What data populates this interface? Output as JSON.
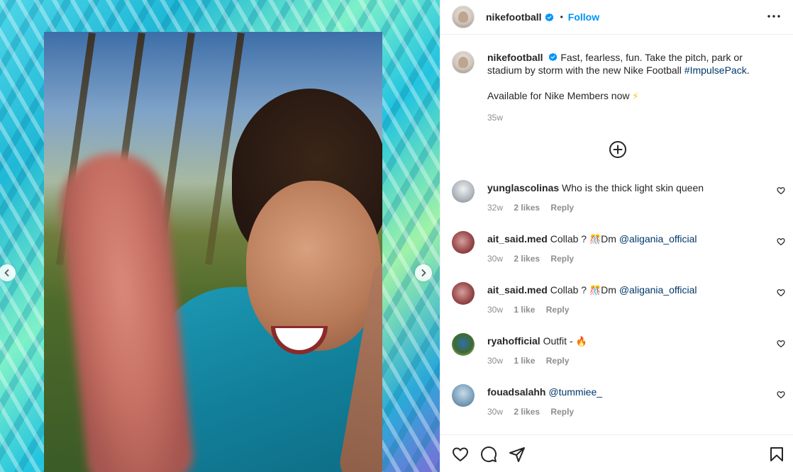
{
  "post": {
    "username": "nikefootball",
    "follow_label": "Follow",
    "separator": "•"
  },
  "caption": {
    "username": "nikefootball",
    "text": "Fast, fearless, fun. Take the pitch, park or stadium by storm with the new Nike Football ",
    "hashtag": "#ImpulsePack",
    "text_end": ".",
    "line2": "Available for Nike Members now",
    "line2_emoji": "⚡",
    "time": "35w"
  },
  "comments": [
    {
      "user": "yunglascolinas",
      "text": "Who is the thick light skin queen",
      "mention": "",
      "emoji": "",
      "time": "32w",
      "likes": "2 likes",
      "reply": "Reply"
    },
    {
      "user": "ait_said.med",
      "text": "Collab ? ",
      "emoji": "🎊",
      "text2": "Dm ",
      "mention": "@aliganiа_official",
      "time": "30w",
      "likes": "2 likes",
      "reply": "Reply"
    },
    {
      "user": "ait_said.med",
      "text": "Collab ? ",
      "emoji": "🎊",
      "text2": "Dm ",
      "mention": "@aliganiа_official",
      "time": "30w",
      "likes": "1 like",
      "reply": "Reply"
    },
    {
      "user": "ryahofficial",
      "text": "Outfit - ",
      "emoji": "🔥",
      "text2": "",
      "mention": "",
      "time": "30w",
      "likes": "1 like",
      "reply": "Reply"
    },
    {
      "user": "fouadsalahh",
      "text": "",
      "emoji": "",
      "text2": "",
      "mention": "@tummiee_",
      "time": "30w",
      "likes": "2 likes",
      "reply": "Reply"
    }
  ],
  "icons": {
    "verified": "verified-badge-icon",
    "more": "more-options-icon",
    "add_comment": "add-circle-icon",
    "like": "heart-icon",
    "comment": "comment-icon",
    "share": "share-icon",
    "save": "bookmark-icon",
    "prev": "chevron-left-icon",
    "next": "chevron-right-icon"
  },
  "colors": {
    "link": "#0095f6",
    "hashtag": "#00376b",
    "secondary_text": "#8e8e8e",
    "verified": "#0095f6"
  }
}
